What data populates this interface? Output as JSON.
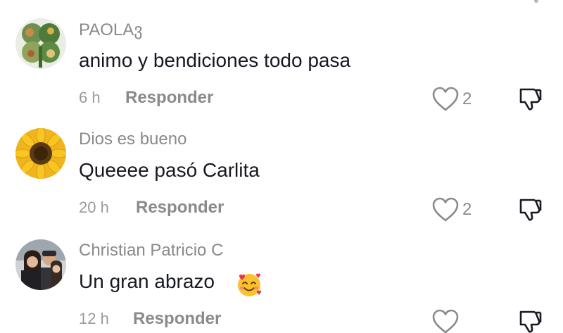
{
  "comments": [
    {
      "username": "PAOLAვ",
      "text": "animo y bendiciones todo pasa",
      "time": "6 h",
      "reply_label": "Responder",
      "like_count": "2",
      "avatar": "clover-collage-avatar"
    },
    {
      "username": "Dios es bueno",
      "text": "Queeee pasó Carlita",
      "time": "20 h",
      "reply_label": "Responder",
      "like_count": "2",
      "avatar": "sunflower-avatar"
    },
    {
      "username": "Christian Patricio C",
      "text": "Un gran abrazo",
      "emoji": "smiling-face-with-hearts",
      "time": "12 h",
      "reply_label": "Responder",
      "like_count": "",
      "avatar": "family-photo-avatar"
    }
  ],
  "colors": {
    "text": "#161823",
    "secondary": "#8a8a8a"
  }
}
